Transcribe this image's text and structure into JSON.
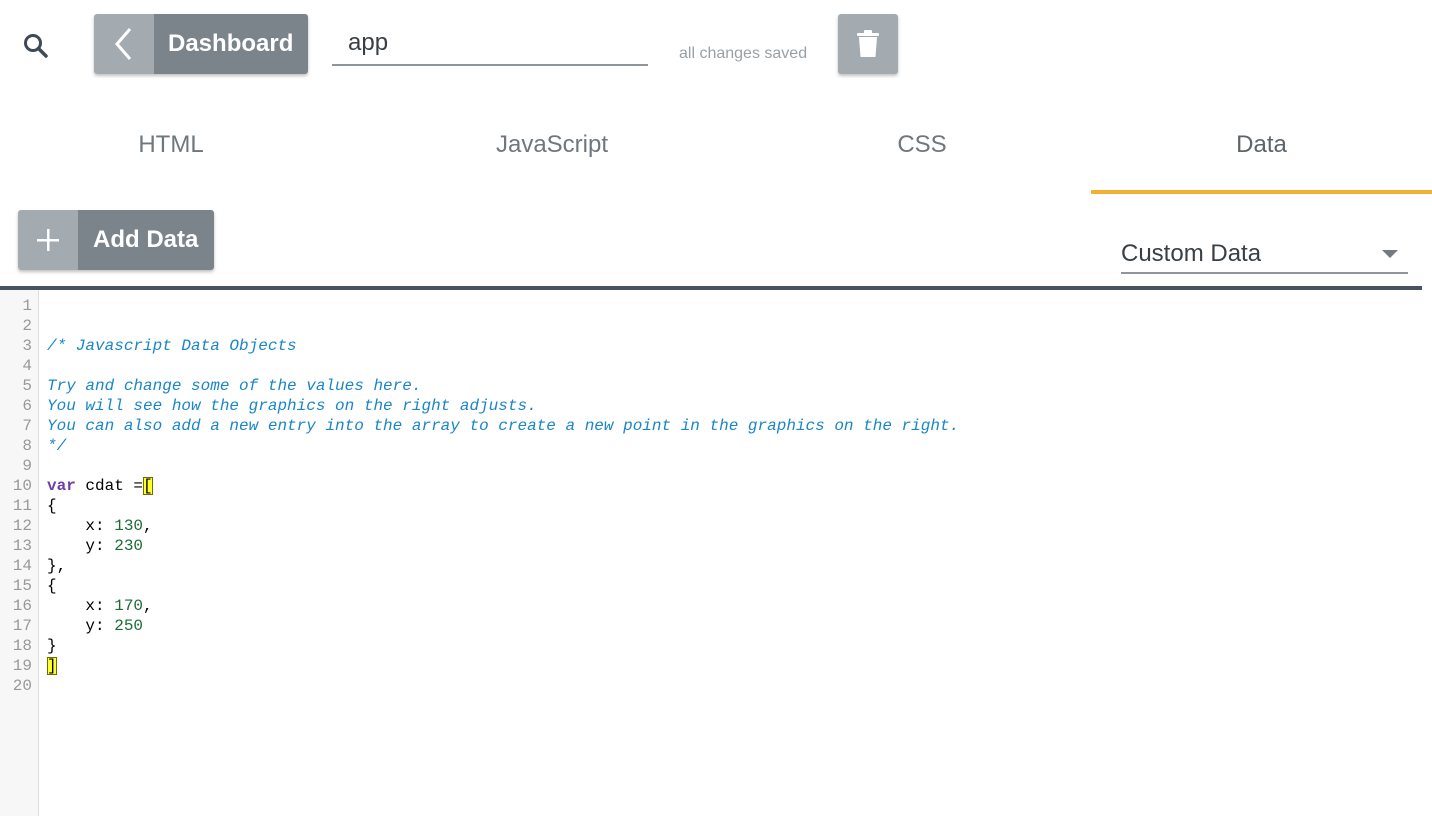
{
  "toolbar": {
    "back_label": "Dashboard",
    "app_name": "app",
    "save_status": "all changes saved"
  },
  "tabs": [
    {
      "label": "HTML",
      "active": false
    },
    {
      "label": "JavaScript",
      "active": false
    },
    {
      "label": "CSS",
      "active": false
    },
    {
      "label": "Data",
      "active": true
    }
  ],
  "data_panel": {
    "add_label": "Add Data",
    "source_select": "Custom Data"
  },
  "icons": {
    "search": "search-icon",
    "back": "chevron-left-icon",
    "delete": "trash-icon",
    "add": "plus-icon",
    "dropdown": "caret-down-icon"
  },
  "colors": {
    "active_tab": "#f0b030",
    "button_dark": "#7b848b",
    "button_light": "#a3abb1",
    "comment": "#1a86c8",
    "keyword": "#6e3fa8",
    "number": "#1c6a36",
    "bracket_highlight": "#ffff2e"
  },
  "editor": {
    "line_numbers": [
      "1",
      "2",
      "3",
      "4",
      "5",
      "6",
      "7",
      "8",
      "9",
      "10",
      "11",
      "12",
      "13",
      "14",
      "15",
      "16",
      "17",
      "18",
      "19",
      "20"
    ],
    "comment": [
      "/* Javascript Data Objects",
      "",
      "Try and change some of the values here.",
      "You will see how the graphics on the right adjusts.",
      "You can also add a new entry into the array to create a new point in the graphics on the right.",
      "*/"
    ],
    "keyword": "var",
    "decl": " cdat =",
    "open_bracket": "[",
    "close_bracket": "]",
    "open_brace": "{",
    "close_brace_comma": "},",
    "close_brace": "}",
    "entries": [
      {
        "x_key": "    x: ",
        "x": "130",
        "y_key": "    y: ",
        "y": "230"
      },
      {
        "x_key": "    x: ",
        "x": "170",
        "y_key": "    y: ",
        "y": "250"
      }
    ],
    "comma": ","
  }
}
